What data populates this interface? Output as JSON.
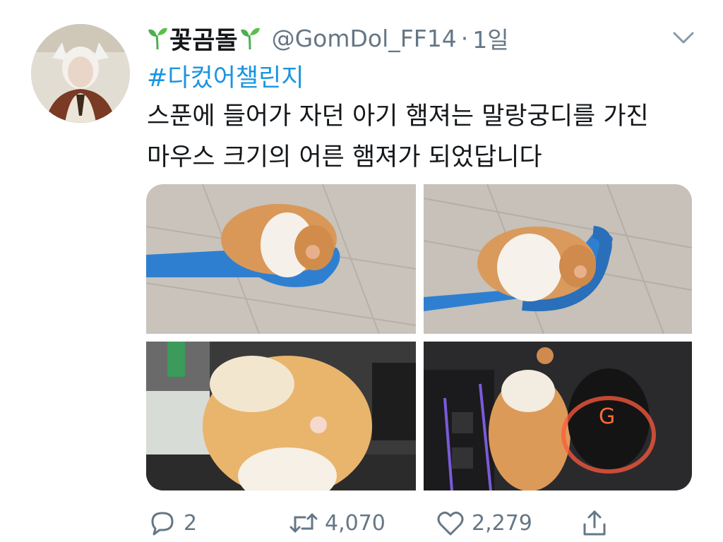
{
  "tweet": {
    "display_name": "꽃곰돌",
    "handle": "@GomDol_FF14",
    "separator": "·",
    "time": "1일",
    "hashtag": "#다컸어챌린지",
    "text_lines": [
      "스푼에 들어가 자던 아기 햄져는 말랑궁디를 가진",
      "마우스 크기의 어른 햄져가 되었답니다"
    ]
  },
  "media": {
    "images": [
      {
        "icon": "hamster-in-blue-spoon-photo"
      },
      {
        "icon": "hamster-in-blue-spoon-photo"
      },
      {
        "icon": "hamster-back-closeup-photo"
      },
      {
        "icon": "hamster-next-to-gaming-mouse-photo"
      }
    ]
  },
  "actions": {
    "reply_count": "2",
    "retweet_count": "4,070",
    "like_count": "2,279"
  },
  "colors": {
    "text": "#14171a",
    "secondary": "#657786",
    "link": "#1b95e0",
    "sprout": "#4caf50"
  }
}
